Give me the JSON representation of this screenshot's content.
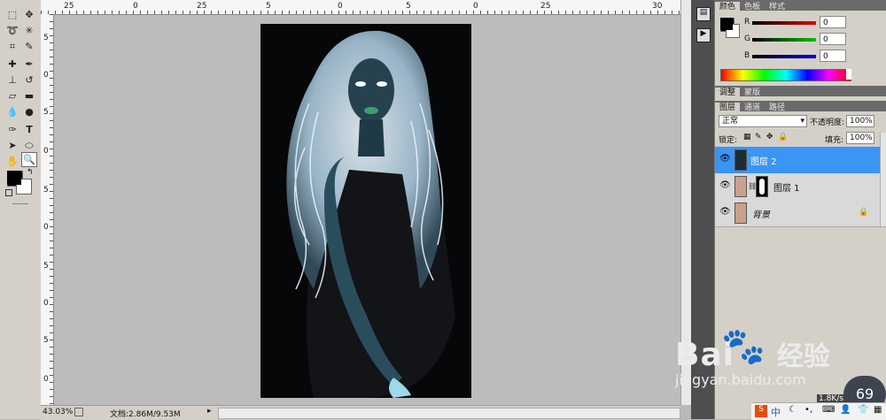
{
  "ruler": {
    "top_labels": [
      "25",
      "0",
      "25",
      "5",
      "0",
      "5",
      "0",
      "25",
      "30"
    ],
    "left_labels": [
      "5",
      "0",
      "5",
      "0",
      "5",
      "0",
      "5",
      "0",
      "5",
      "0"
    ]
  },
  "status": {
    "zoom": "43.03%",
    "doc_info": "文档:2.86M/9.53M"
  },
  "color_panel": {
    "tabs": [
      "颜色",
      "色板",
      "样式"
    ],
    "channels": [
      {
        "label": "R",
        "value": "0",
        "color": "#d00000"
      },
      {
        "label": "G",
        "value": "0",
        "color": "#00b000"
      },
      {
        "label": "B",
        "value": "0",
        "color": "#0000d0"
      }
    ]
  },
  "adjust_panel": {
    "tabs": [
      "调整",
      "蒙版"
    ]
  },
  "layers_panel": {
    "tabs": [
      "图层",
      "通道",
      "路径"
    ],
    "blend_mode": "正常",
    "opacity_label": "不透明度:",
    "opacity_value": "100%",
    "lock_label": "锁定:",
    "fill_label": "填充:",
    "fill_value": "100%",
    "layers": [
      {
        "name": "图层 2",
        "selected": true
      },
      {
        "name": "图层 1",
        "selected": false
      },
      {
        "name": "背景",
        "selected": false
      }
    ]
  },
  "watermark": {
    "brand": "Bai",
    "brand_cn": "经验",
    "url": "jingyan.baidu.com"
  },
  "overlay": {
    "badge": "69",
    "speed": "1.8K/s",
    "taskbar_text": "中"
  }
}
